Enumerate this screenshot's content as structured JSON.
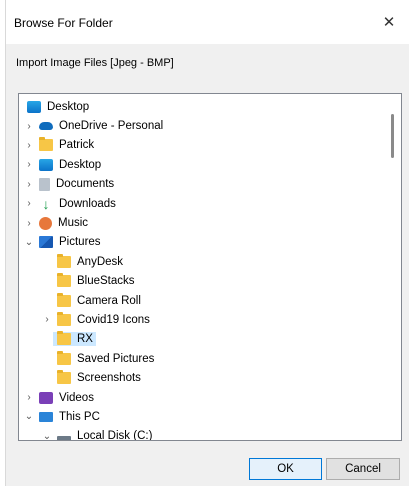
{
  "dialog": {
    "title": "Browse For Folder",
    "close_glyph": "✕",
    "instruction": "Import Image Files [Jpeg - BMP]"
  },
  "tree": {
    "items": [
      {
        "label": "Desktop",
        "indent": 0,
        "chevron": "",
        "icon": "desktop-icon",
        "selected": false
      },
      {
        "label": "OneDrive - Personal",
        "indent": 1,
        "chevron": ">",
        "icon": "onedrive-icon",
        "selected": false
      },
      {
        "label": "Patrick",
        "indent": 1,
        "chevron": ">",
        "icon": "user-folder-icon",
        "selected": false
      },
      {
        "label": "Desktop",
        "indent": 1,
        "chevron": ">",
        "icon": "desktop-icon",
        "selected": false
      },
      {
        "label": "Documents",
        "indent": 1,
        "chevron": ">",
        "icon": "documents-icon",
        "selected": false
      },
      {
        "label": "Downloads",
        "indent": 1,
        "chevron": ">",
        "icon": "downloads-icon",
        "selected": false
      },
      {
        "label": "Music",
        "indent": 1,
        "chevron": ">",
        "icon": "music-icon",
        "selected": false
      },
      {
        "label": "Pictures",
        "indent": 1,
        "chevron": "v",
        "icon": "pictures-icon",
        "selected": false
      },
      {
        "label": "AnyDesk",
        "indent": 2,
        "chevron": "",
        "icon": "folder-icon",
        "selected": false
      },
      {
        "label": "BlueStacks",
        "indent": 2,
        "chevron": "",
        "icon": "folder-icon",
        "selected": false
      },
      {
        "label": "Camera Roll",
        "indent": 2,
        "chevron": "",
        "icon": "folder-icon",
        "selected": false
      },
      {
        "label": "Covid19 Icons",
        "indent": 2,
        "chevron": ">",
        "icon": "folder-icon",
        "selected": false
      },
      {
        "label": "RX",
        "indent": 2,
        "chevron": "",
        "icon": "folder-icon",
        "selected": true
      },
      {
        "label": "Saved Pictures",
        "indent": 2,
        "chevron": "",
        "icon": "folder-icon",
        "selected": false
      },
      {
        "label": "Screenshots",
        "indent": 2,
        "chevron": "",
        "icon": "folder-icon",
        "selected": false
      },
      {
        "label": "Videos",
        "indent": 1,
        "chevron": ">",
        "icon": "videos-icon",
        "selected": false
      },
      {
        "label": "This PC",
        "indent": 1,
        "chevron": "v",
        "icon": "this-pc-icon",
        "selected": false
      },
      {
        "label": "Local Disk (C:)",
        "indent": 2,
        "chevron": "v",
        "icon": "local-disk-icon",
        "selected": false
      }
    ]
  },
  "buttons": {
    "ok": "OK",
    "cancel": "Cancel"
  },
  "colors": {
    "selection": "#cce8ff",
    "accent": "#0078d7"
  }
}
